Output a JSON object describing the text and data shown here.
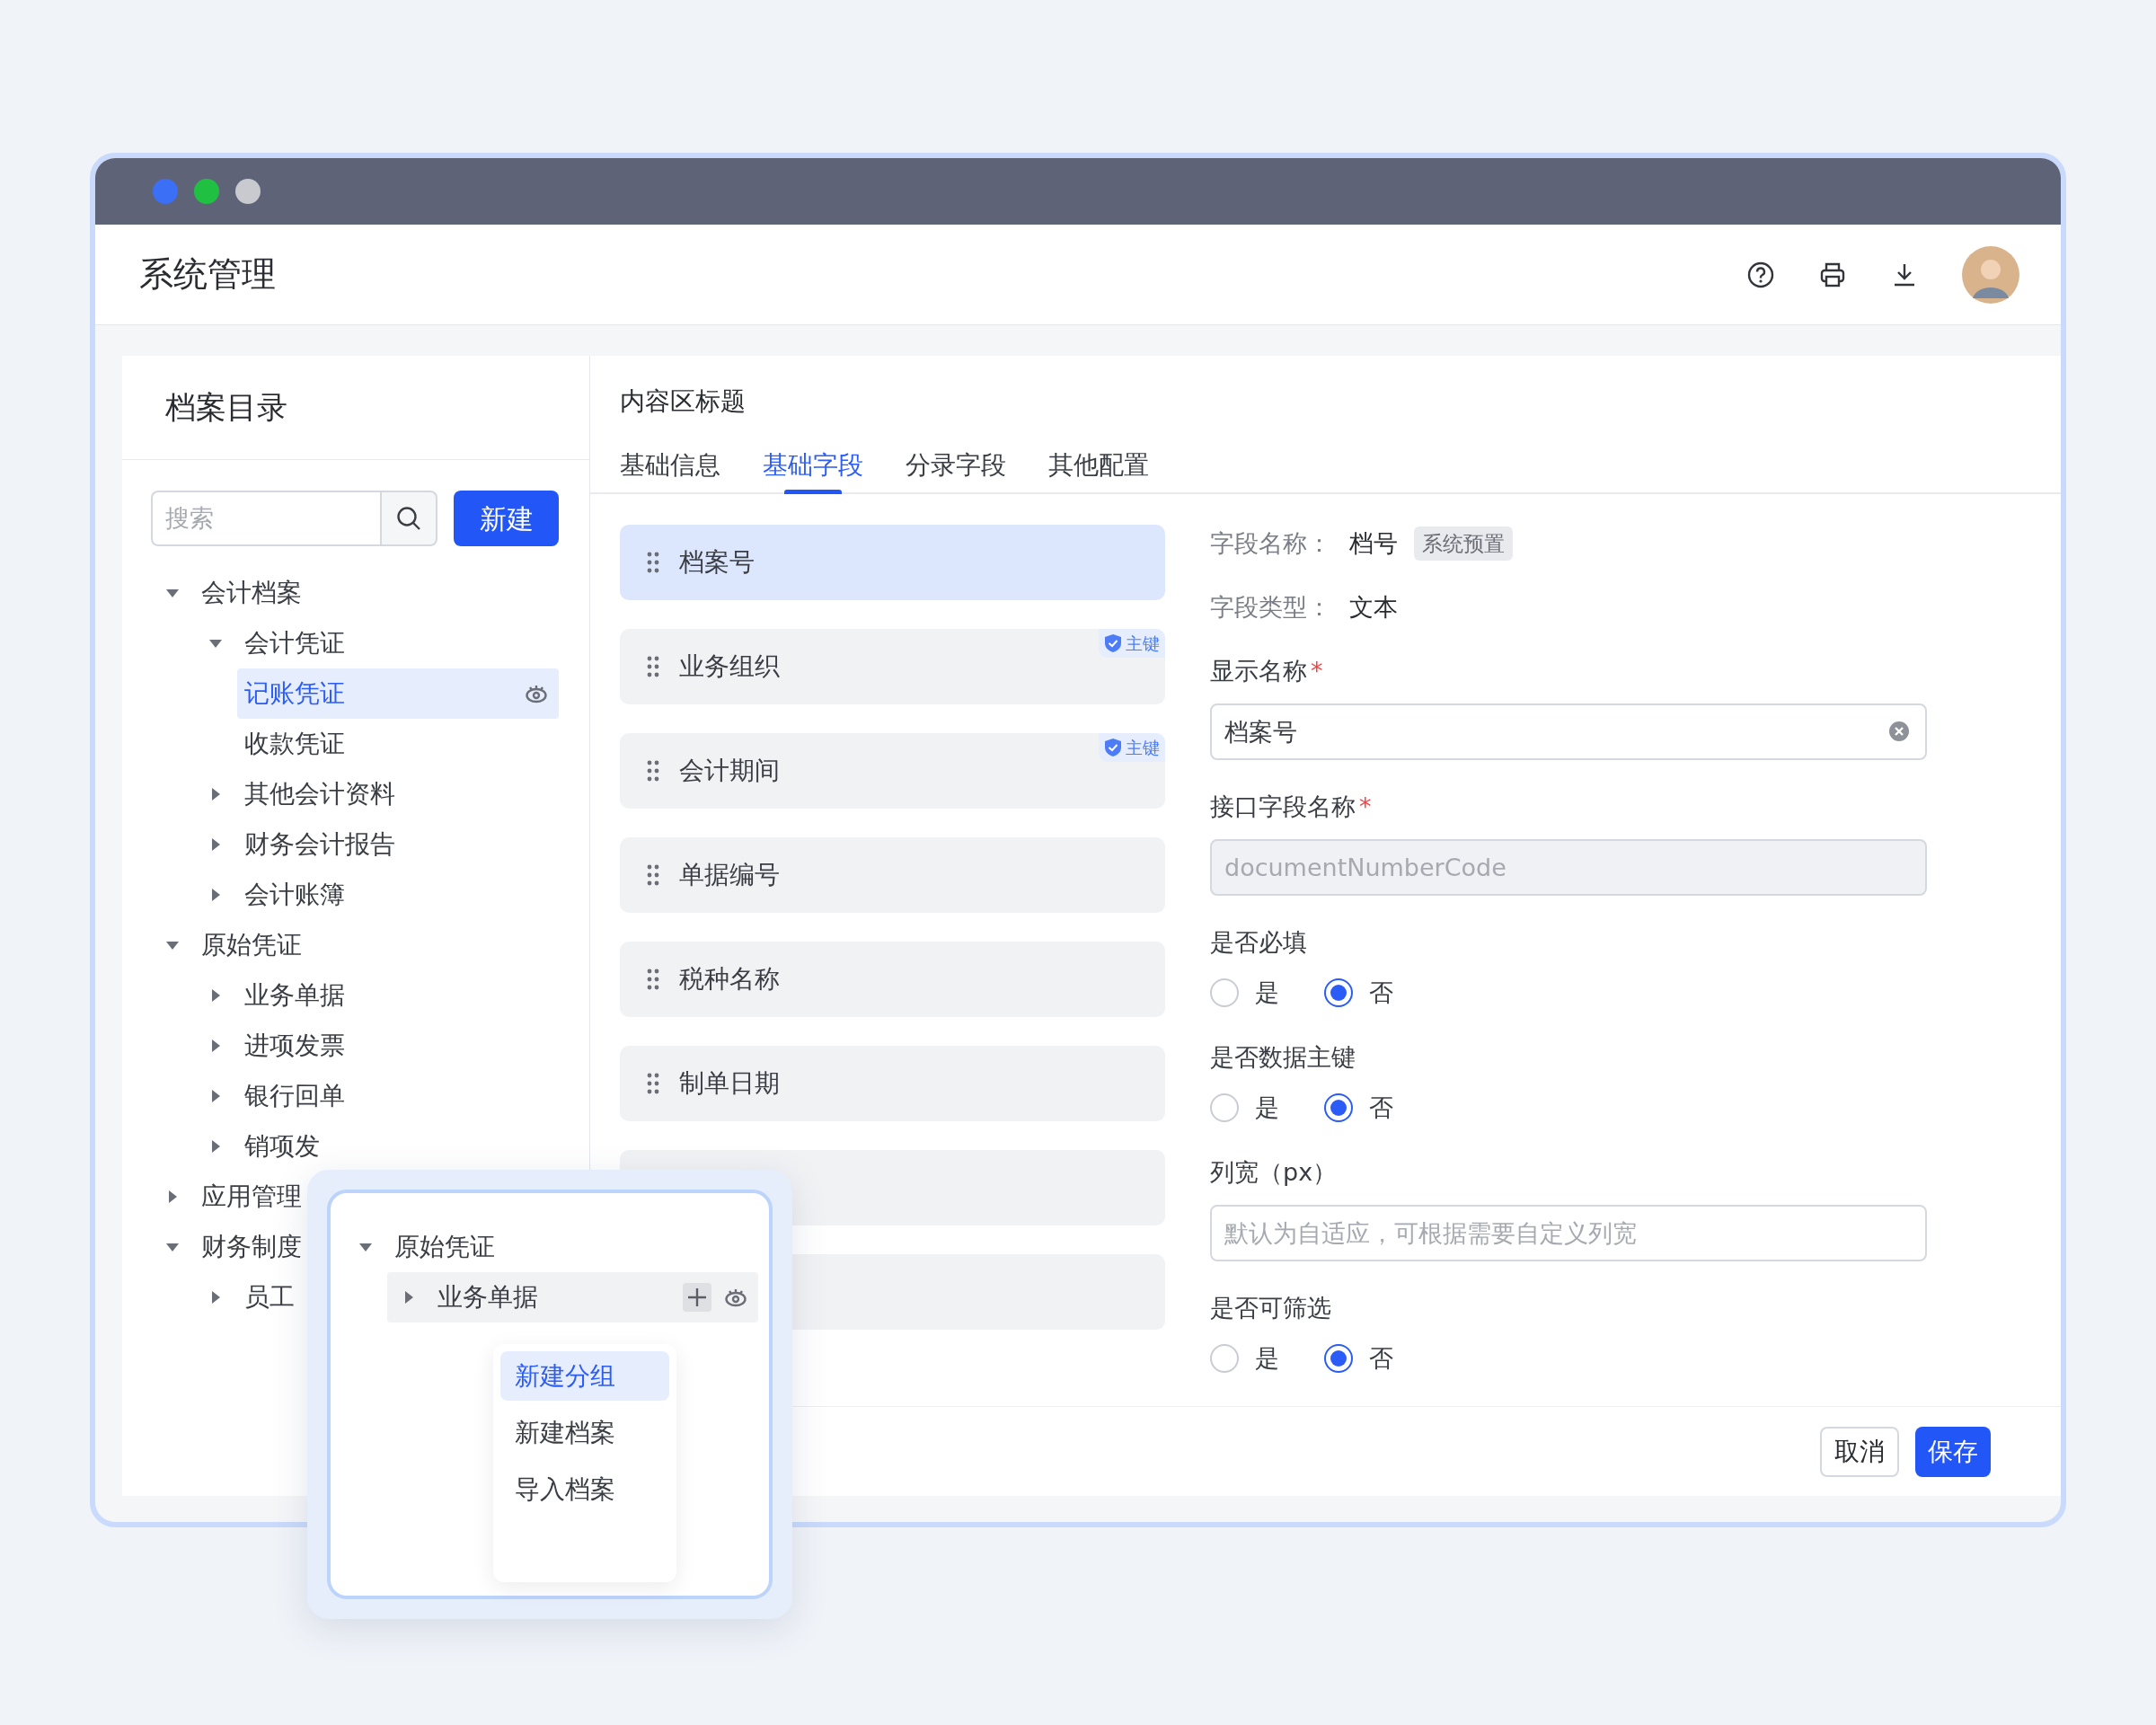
{
  "window": {
    "title": "系统管理"
  },
  "sidebar": {
    "title": "档案目录",
    "search": {
      "placeholder": "搜索"
    },
    "new_button": "新建",
    "tree": [
      {
        "label": "会计档案",
        "expanded": true,
        "selected": false,
        "children": [
          {
            "label": "会计凭证",
            "expanded": true,
            "selected": false,
            "children": [
              {
                "label": "记账凭证",
                "selected": true
              },
              {
                "label": "收款凭证",
                "selected": false
              }
            ]
          },
          {
            "label": "其他会计资料",
            "expanded": false,
            "selected": false
          },
          {
            "label": "财务会计报告",
            "expanded": false,
            "selected": false
          },
          {
            "label": "会计账簿",
            "expanded": false,
            "selected": false
          }
        ]
      },
      {
        "label": "原始凭证",
        "expanded": true,
        "selected": false,
        "children": [
          {
            "label": "业务单据",
            "expanded": false,
            "selected": false
          },
          {
            "label": "进项发票",
            "expanded": false,
            "selected": false
          },
          {
            "label": "银行回单",
            "expanded": false,
            "selected": false
          },
          {
            "label": "销项发",
            "expanded": false,
            "selected": false
          }
        ]
      },
      {
        "label": "应用管理",
        "expanded": false,
        "selected": false
      },
      {
        "label": "财务制度",
        "expanded": true,
        "selected": false,
        "children": [
          {
            "label": "员工",
            "expanded": false,
            "selected": false
          }
        ]
      }
    ]
  },
  "content": {
    "title": "内容区标题",
    "tabs": [
      {
        "label": "基础信息",
        "selected": false
      },
      {
        "label": "基础字段",
        "selected": true
      },
      {
        "label": "分录字段",
        "selected": false
      },
      {
        "label": "其他配置",
        "selected": false
      }
    ],
    "fields": [
      {
        "label": "档案号",
        "selected": true
      },
      {
        "label": "业务组织",
        "selected": false,
        "badge": "主键"
      },
      {
        "label": "会计期间",
        "selected": false,
        "badge": "主键"
      },
      {
        "label": "单据编号",
        "selected": false
      },
      {
        "label": "税种名称",
        "selected": false
      },
      {
        "label": "制单日期",
        "selected": false
      },
      {
        "selected": false
      },
      {
        "selected": false
      }
    ],
    "detail": {
      "info": [
        {
          "label": "字段名称：",
          "value": "档号",
          "tag": "系统预置"
        },
        {
          "label": "字段类型：",
          "value": "文本"
        }
      ],
      "form": [
        {
          "kind": "text",
          "label": "显示名称",
          "required_mark": "*",
          "value": "档案号",
          "clearable": true,
          "disabled": false
        },
        {
          "kind": "text",
          "label": "接口字段名称",
          "required_mark": "*",
          "value": "documentNumberCode",
          "disabled": true
        },
        {
          "kind": "radio",
          "label": "是否必填",
          "options": [
            {
              "label": "是",
              "selected": false
            },
            {
              "label": "否",
              "selected": true
            }
          ]
        },
        {
          "kind": "radio",
          "label": "是否数据主键",
          "options": [
            {
              "label": "是",
              "selected": false
            },
            {
              "label": "否",
              "selected": true
            }
          ]
        },
        {
          "kind": "text",
          "label": "列宽（px）",
          "placeholder": "默认为自适应，可根据需要自定义列宽",
          "disabled": false
        },
        {
          "kind": "radio",
          "label": "是否可筛选",
          "options": [
            {
              "label": "是",
              "selected": false
            },
            {
              "label": "否",
              "selected": true
            }
          ]
        }
      ]
    },
    "buttons": {
      "cancel": "取消",
      "save": "保存"
    }
  },
  "popup": {
    "tree": [
      {
        "label": "原始凭证",
        "expanded": true,
        "children": [
          {
            "label": "业务单据",
            "expanded": false,
            "highlighted": true
          }
        ]
      }
    ],
    "menu": [
      {
        "label": "新建分组",
        "selected": true
      },
      {
        "label": "新建档案",
        "selected": false
      },
      {
        "label": "导入档案",
        "selected": false
      }
    ]
  }
}
